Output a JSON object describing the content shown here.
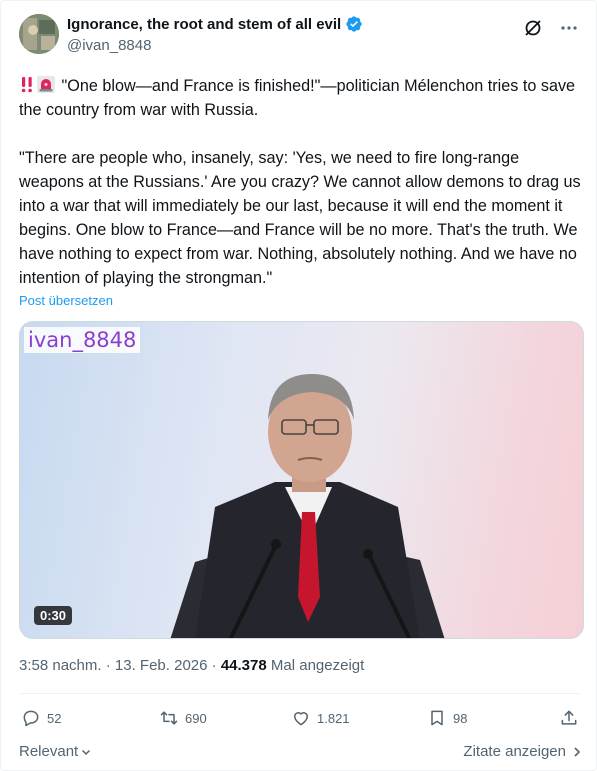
{
  "author": {
    "display_name": "Ignorance, the root and stem of all evil",
    "handle": "@ivan_8848",
    "verified": true
  },
  "post": {
    "paragraph1": "\"One blow—and France is finished!\"—politician Mélenchon tries to save the country from war with Russia.",
    "paragraph2": "\"There are people who, insanely, say: 'Yes, we need to fire long-range weapons at the Russians.' Are you crazy? We cannot allow demons to drag us into a war that will immediately be our last, because it will end the moment it begins. One blow to France—and France will be no more. That's the truth. We have nothing to expect from war. Nothing, absolutely nothing. And we have no intention of playing the strongman.\"",
    "translate_label": "Post übersetzen"
  },
  "media": {
    "watermark": "ivan_8848",
    "duration": "0:30"
  },
  "meta": {
    "time": "3:58 nachm.",
    "date": "13. Feb. 2026",
    "views_count": "44.378",
    "views_label": "Mal angezeigt"
  },
  "actions": {
    "replies": "52",
    "reposts": "690",
    "likes": "1.821",
    "bookmarks": "98"
  },
  "footer": {
    "sort_label": "Relevant",
    "quotes_label": "Zitate anzeigen"
  },
  "colors": {
    "accent": "#1d9bf0",
    "text": "#0f1419",
    "secondary": "#536471"
  }
}
